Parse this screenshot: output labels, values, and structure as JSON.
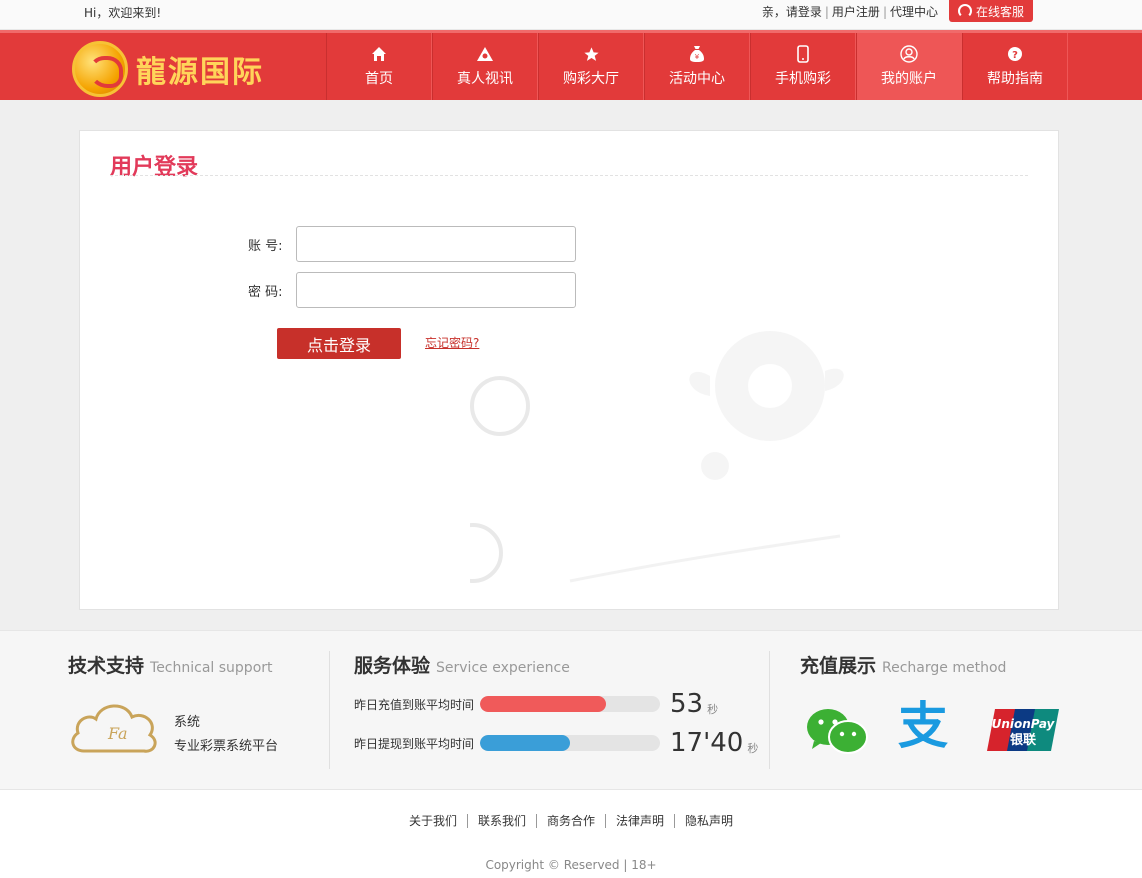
{
  "topbar": {
    "greeting": "Hi，欢迎来到!",
    "links": [
      "亲，请登录",
      "用户注册",
      "代理中心"
    ],
    "service_label": "在线客服"
  },
  "header": {
    "logo_text": "龍源国际",
    "nav": [
      {
        "label": "首页",
        "icon": "home-icon"
      },
      {
        "label": "真人视讯",
        "icon": "triangle-icon"
      },
      {
        "label": "购彩大厅",
        "icon": "star-icon"
      },
      {
        "label": "活动中心",
        "icon": "money-bag-icon"
      },
      {
        "label": "手机购彩",
        "icon": "phone-icon"
      },
      {
        "label": "我的账户",
        "icon": "user-icon",
        "active": true
      },
      {
        "label": "帮助指南",
        "icon": "help-icon"
      }
    ]
  },
  "login": {
    "title": "用户登录",
    "account_label": "账 号:",
    "password_label": "密 码:",
    "submit_label": "点击登录",
    "forgot_label": "忘记密码?"
  },
  "info": {
    "support": {
      "title": "技术支持",
      "title_en": "Technical support",
      "line1": "系统",
      "line2": "专业彩票系统平台"
    },
    "service": {
      "title": "服务体验",
      "title_en": "Service experience",
      "stats": [
        {
          "label": "昨日充值到账平均时间",
          "value": "53",
          "unit": "秒",
          "fill_pct": 70,
          "color": "#f05a5a"
        },
        {
          "label": "昨日提现到账平均时间",
          "value": "17'40",
          "unit": "秒",
          "fill_pct": 50,
          "color": "#3a9ed8"
        }
      ]
    },
    "recharge": {
      "title": "充值展示",
      "title_en": "Recharge method",
      "methods": [
        "wechat-icon",
        "alipay-icon",
        "unionpay-icon"
      ],
      "unionpay_text": "UnionPay",
      "unionpay_cn": "银联",
      "alipay_char": "支"
    }
  },
  "footer": {
    "links": [
      "关于我们",
      "联系我们",
      "商务合作",
      "法律声明",
      "隐私声明"
    ],
    "copyright": "Copyright © Reserved | 18+"
  }
}
